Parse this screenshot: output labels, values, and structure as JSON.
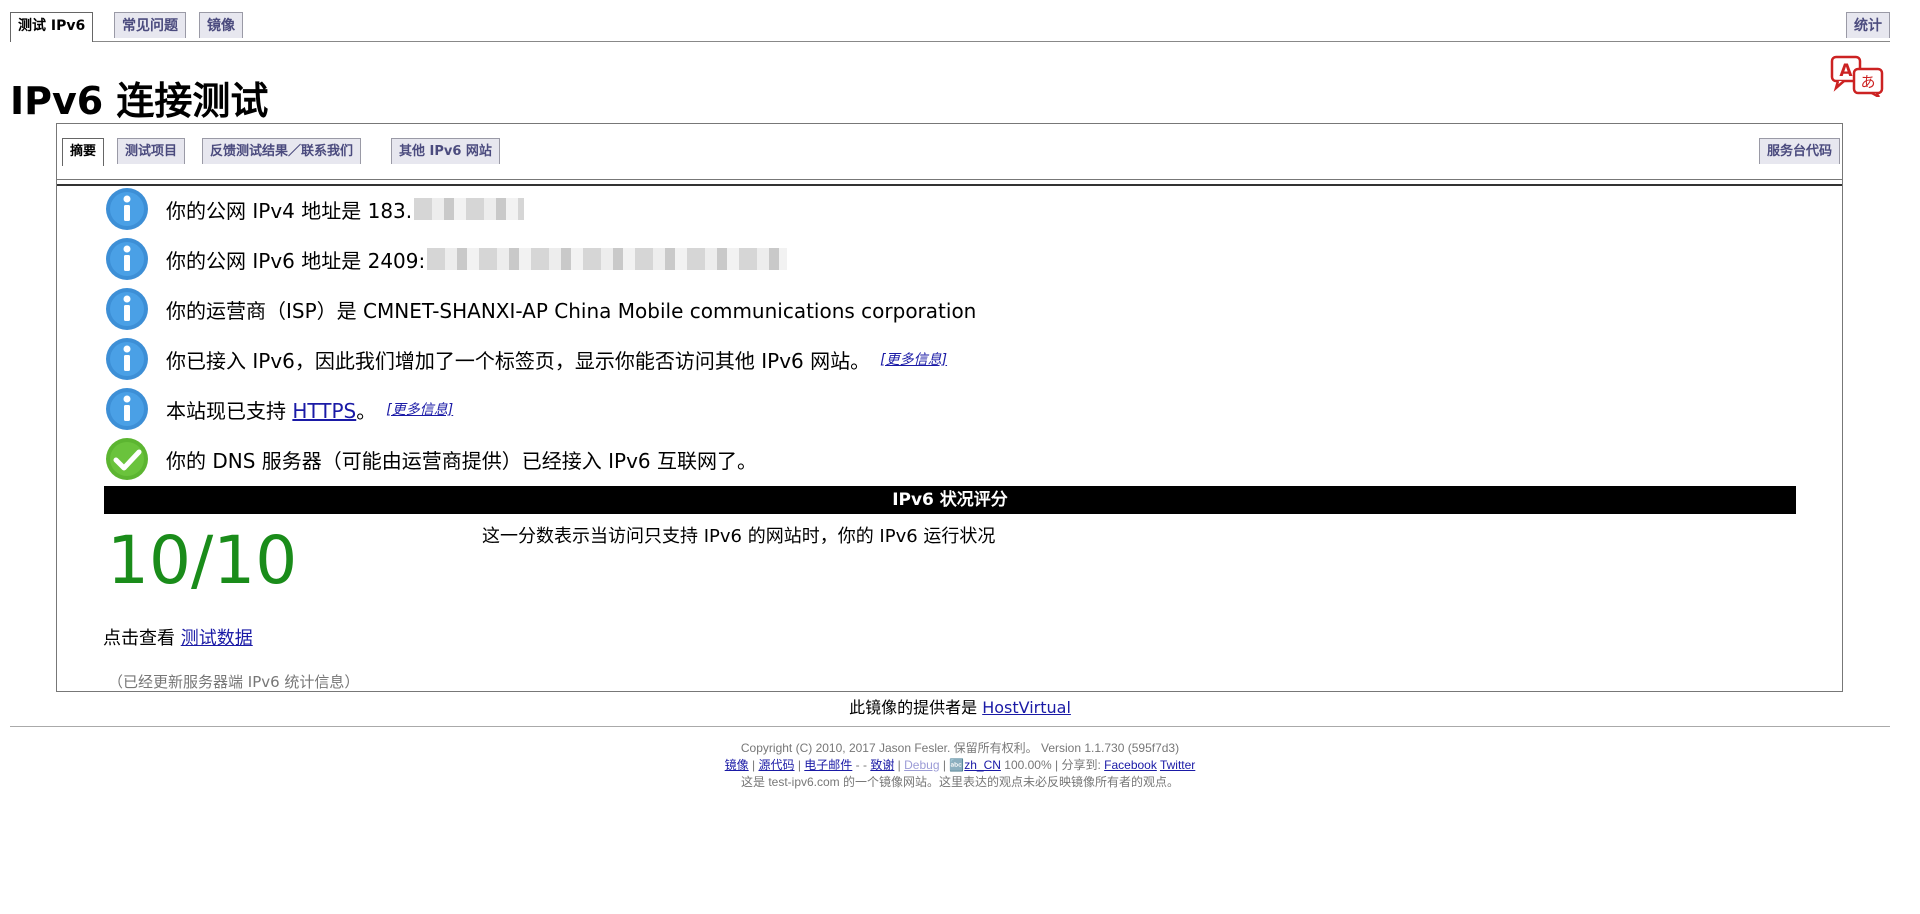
{
  "top_tabs": {
    "test": "测试 IPv6",
    "faq": "常见问题",
    "mirror": "镜像",
    "stats": "统计"
  },
  "page_title": "IPv6 连接测试",
  "inner_tabs": {
    "summary": "摘要",
    "tests": "测试项目",
    "feedback": "反馈测试结果／联系我们",
    "other_sites": "其他 IPv6 网站",
    "server_code": "服务台代码"
  },
  "messages": {
    "ipv4": "你的公网 IPv4 地址是 183.",
    "ipv6": "你的公网 IPv6 地址是 2409:",
    "isp": "你的运营商（ISP）是 CMNET-SHANXI-AP China Mobile communications corporation",
    "tab_added": "你已接入 IPv6，因此我们增加了一个标签页，显示你能否访问其他 IPv6 网站。",
    "more_info": "[更多信息]",
    "https_prefix": "本站现已支持 ",
    "https_link": "HTTPS",
    "https_suffix": "。",
    "dns": "你的 DNS 服务器（可能由运营商提供）已经接入 IPv6 互联网了。"
  },
  "score": {
    "header": "IPv6 状况评分",
    "value": "10/10",
    "description": "这一分数表示当访问只支持 IPv6 的网站时，你的 IPv6 运行状况",
    "view_prefix": "点击查看 ",
    "view_link": "测试数据",
    "update_note": "（已经更新服务器端 IPv6 统计信息）"
  },
  "provider": {
    "prefix": "此镜像的提供者是 ",
    "name": "HostVirtual"
  },
  "footer": {
    "copyright": "Copyright (C) 2010, 2017 Jason Fesler. 保留所有权利。 Version 1.1.730 (595f7d3)",
    "mirrors": "镜像",
    "source": "源代码",
    "email": "电子邮件",
    "thanks": "致谢",
    "debug": "Debug",
    "locale": "zh_CN",
    "locale_pct": "100.00%",
    "share": "分享到:",
    "facebook": "Facebook",
    "twitter": "Twitter",
    "mirror_note": "这是 test-ipv6.com 的一个镜像网站。这里表达的观点未必反映镜像所有者的观点。"
  },
  "colors": {
    "score_green": "#1a8c1a",
    "link": "#1a1aa6",
    "info_blue": "#3d8fd6",
    "ok_green": "#5cb531"
  }
}
